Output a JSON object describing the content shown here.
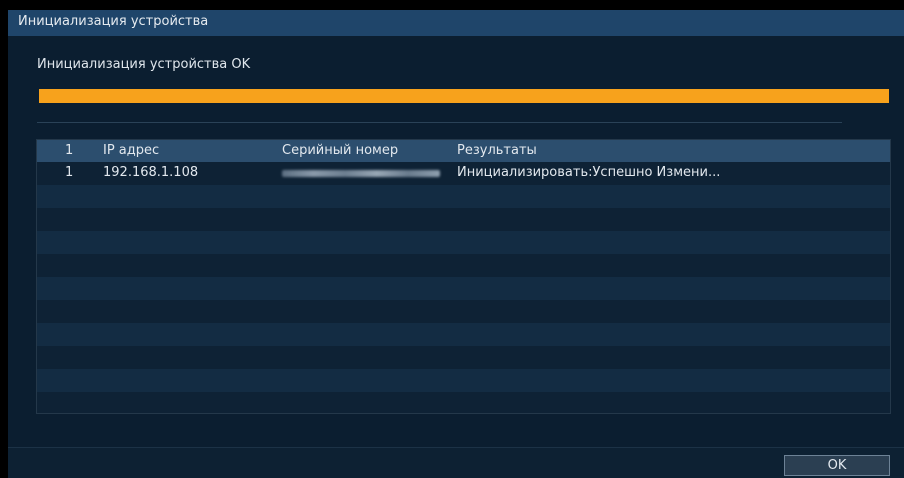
{
  "window": {
    "title": "Инициализация устройства"
  },
  "status": {
    "text": "Инициализация устройства OK",
    "progress_percent": 100,
    "progress_color": "#f7a21c"
  },
  "table": {
    "columns": [
      "1",
      "IP адрес",
      "Серийный номер",
      "Результаты"
    ],
    "rows": [
      {
        "no": "1",
        "ip": "192.168.1.108",
        "serial": "(blurred)",
        "result": "Инициализировать:Успешно Измени..."
      }
    ],
    "empty_row_count": 10
  },
  "buttons": {
    "ok_label": "OK"
  }
}
